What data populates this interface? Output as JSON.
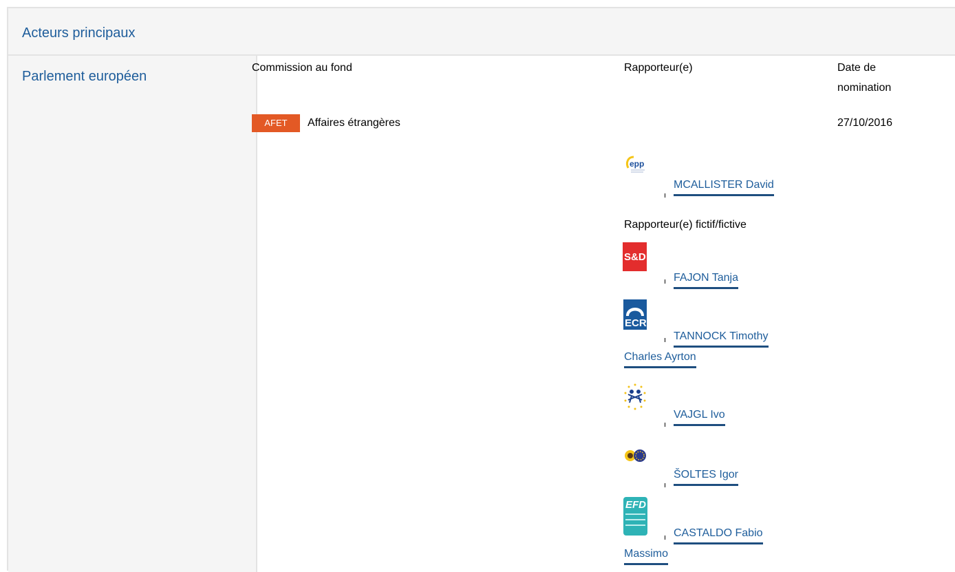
{
  "section": {
    "title": "Acteurs principaux"
  },
  "institution": {
    "name": "Parlement européen"
  },
  "columns": {
    "committee": "Commission au fond",
    "rapporteur": "Rapporteur(e)",
    "date_line1": "Date de",
    "date_line2": "nomination"
  },
  "committee": {
    "code": "AFET",
    "name": "Affaires étrangères",
    "date": "27/10/2016",
    "badge_color": "#e35925"
  },
  "rapporteur": {
    "group_icon": "epp-logo",
    "name": "MCALLISTER David"
  },
  "shadow": {
    "label": "Rapporteur(e) fictif/fictive",
    "members": [
      {
        "group_icon": "sd-logo",
        "logo_text": "S&D",
        "name_line1": "FAJON Tanja",
        "name_line2": ""
      },
      {
        "group_icon": "ecr-logo",
        "logo_text": "ECR",
        "name_line1": "TANNOCK Timothy",
        "name_line2": "Charles Ayrton"
      },
      {
        "group_icon": "alde-logo",
        "name_line1": "VAJGL Ivo",
        "name_line2": ""
      },
      {
        "group_icon": "greens-efa-logo",
        "name_line1": "ŠOLTES Igor",
        "name_line2": ""
      },
      {
        "group_icon": "efdd-logo",
        "logo_text": "EFD",
        "name_line1": "CASTALDO Fabio",
        "name_line2": "Massimo"
      }
    ]
  },
  "colors": {
    "link": "#1e5d9b",
    "header_bg": "#f5f5f5",
    "underline": "#1e4e7f"
  }
}
